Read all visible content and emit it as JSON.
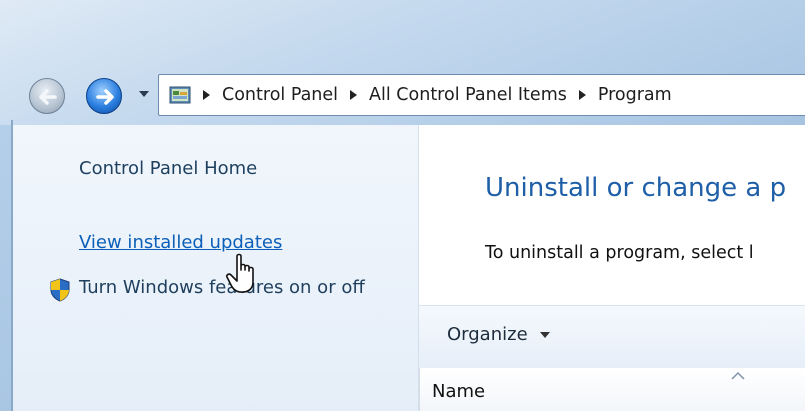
{
  "navigation": {
    "back_icon": "back-arrow-icon",
    "forward_icon": "forward-arrow-icon",
    "recent_pages_icon": "chevron-down-icon"
  },
  "address_bar": {
    "location_icon": "control-panel-icon",
    "crumbs": [
      "Control Panel",
      "All Control Panel Items",
      "Program"
    ]
  },
  "left_pane": {
    "home_link": "Control Panel Home",
    "updates_link": "View installed updates",
    "features_link": "Turn Windows features on or off",
    "features_icon": "uac-shield-icon"
  },
  "main": {
    "title": "Uninstall or change a p",
    "description": "To uninstall a program, select l",
    "toolbar": {
      "organize_label": "Organize"
    },
    "columns": {
      "name_label": "Name"
    }
  },
  "colors": {
    "link": "#0b5fb8",
    "title": "#1e5fa8",
    "nav_forward": "#2b7fe0"
  }
}
